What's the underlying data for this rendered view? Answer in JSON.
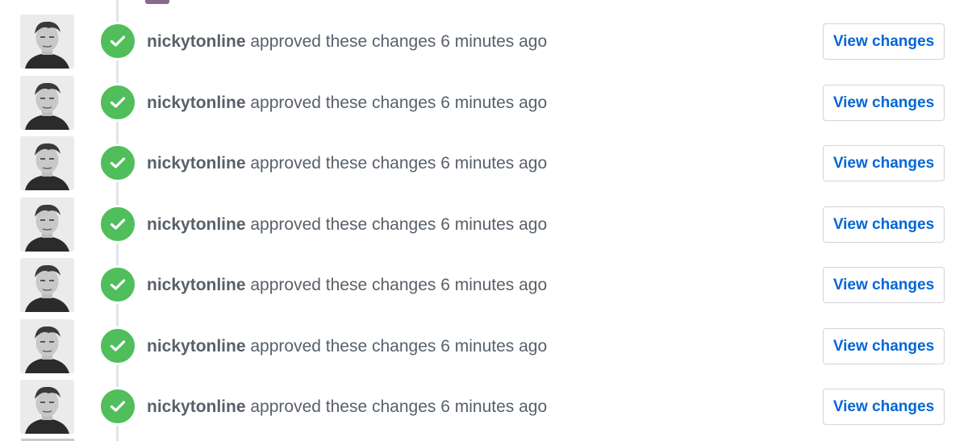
{
  "timeline": {
    "events": [
      {
        "user": "nickytonline",
        "action": "approved these changes",
        "time": "6 minutes ago",
        "button_label": "View changes",
        "status_icon": "check-icon"
      },
      {
        "user": "nickytonline",
        "action": "approved these changes",
        "time": "6 minutes ago",
        "button_label": "View changes",
        "status_icon": "check-icon"
      },
      {
        "user": "nickytonline",
        "action": "approved these changes",
        "time": "6 minutes ago",
        "button_label": "View changes",
        "status_icon": "check-icon"
      },
      {
        "user": "nickytonline",
        "action": "approved these changes",
        "time": "6 minutes ago",
        "button_label": "View changes",
        "status_icon": "check-icon"
      },
      {
        "user": "nickytonline",
        "action": "approved these changes",
        "time": "6 minutes ago",
        "button_label": "View changes",
        "status_icon": "check-icon"
      },
      {
        "user": "nickytonline",
        "action": "approved these changes",
        "time": "6 minutes ago",
        "button_label": "View changes",
        "status_icon": "check-icon"
      },
      {
        "user": "nickytonline",
        "action": "approved these changes",
        "time": "6 minutes ago",
        "button_label": "View changes",
        "status_icon": "check-icon"
      }
    ]
  },
  "colors": {
    "approved_green": "#4fbe5b",
    "link_blue": "#0366d6",
    "text_gray": "#586069",
    "timeline_gray": "#e1e4e8"
  }
}
